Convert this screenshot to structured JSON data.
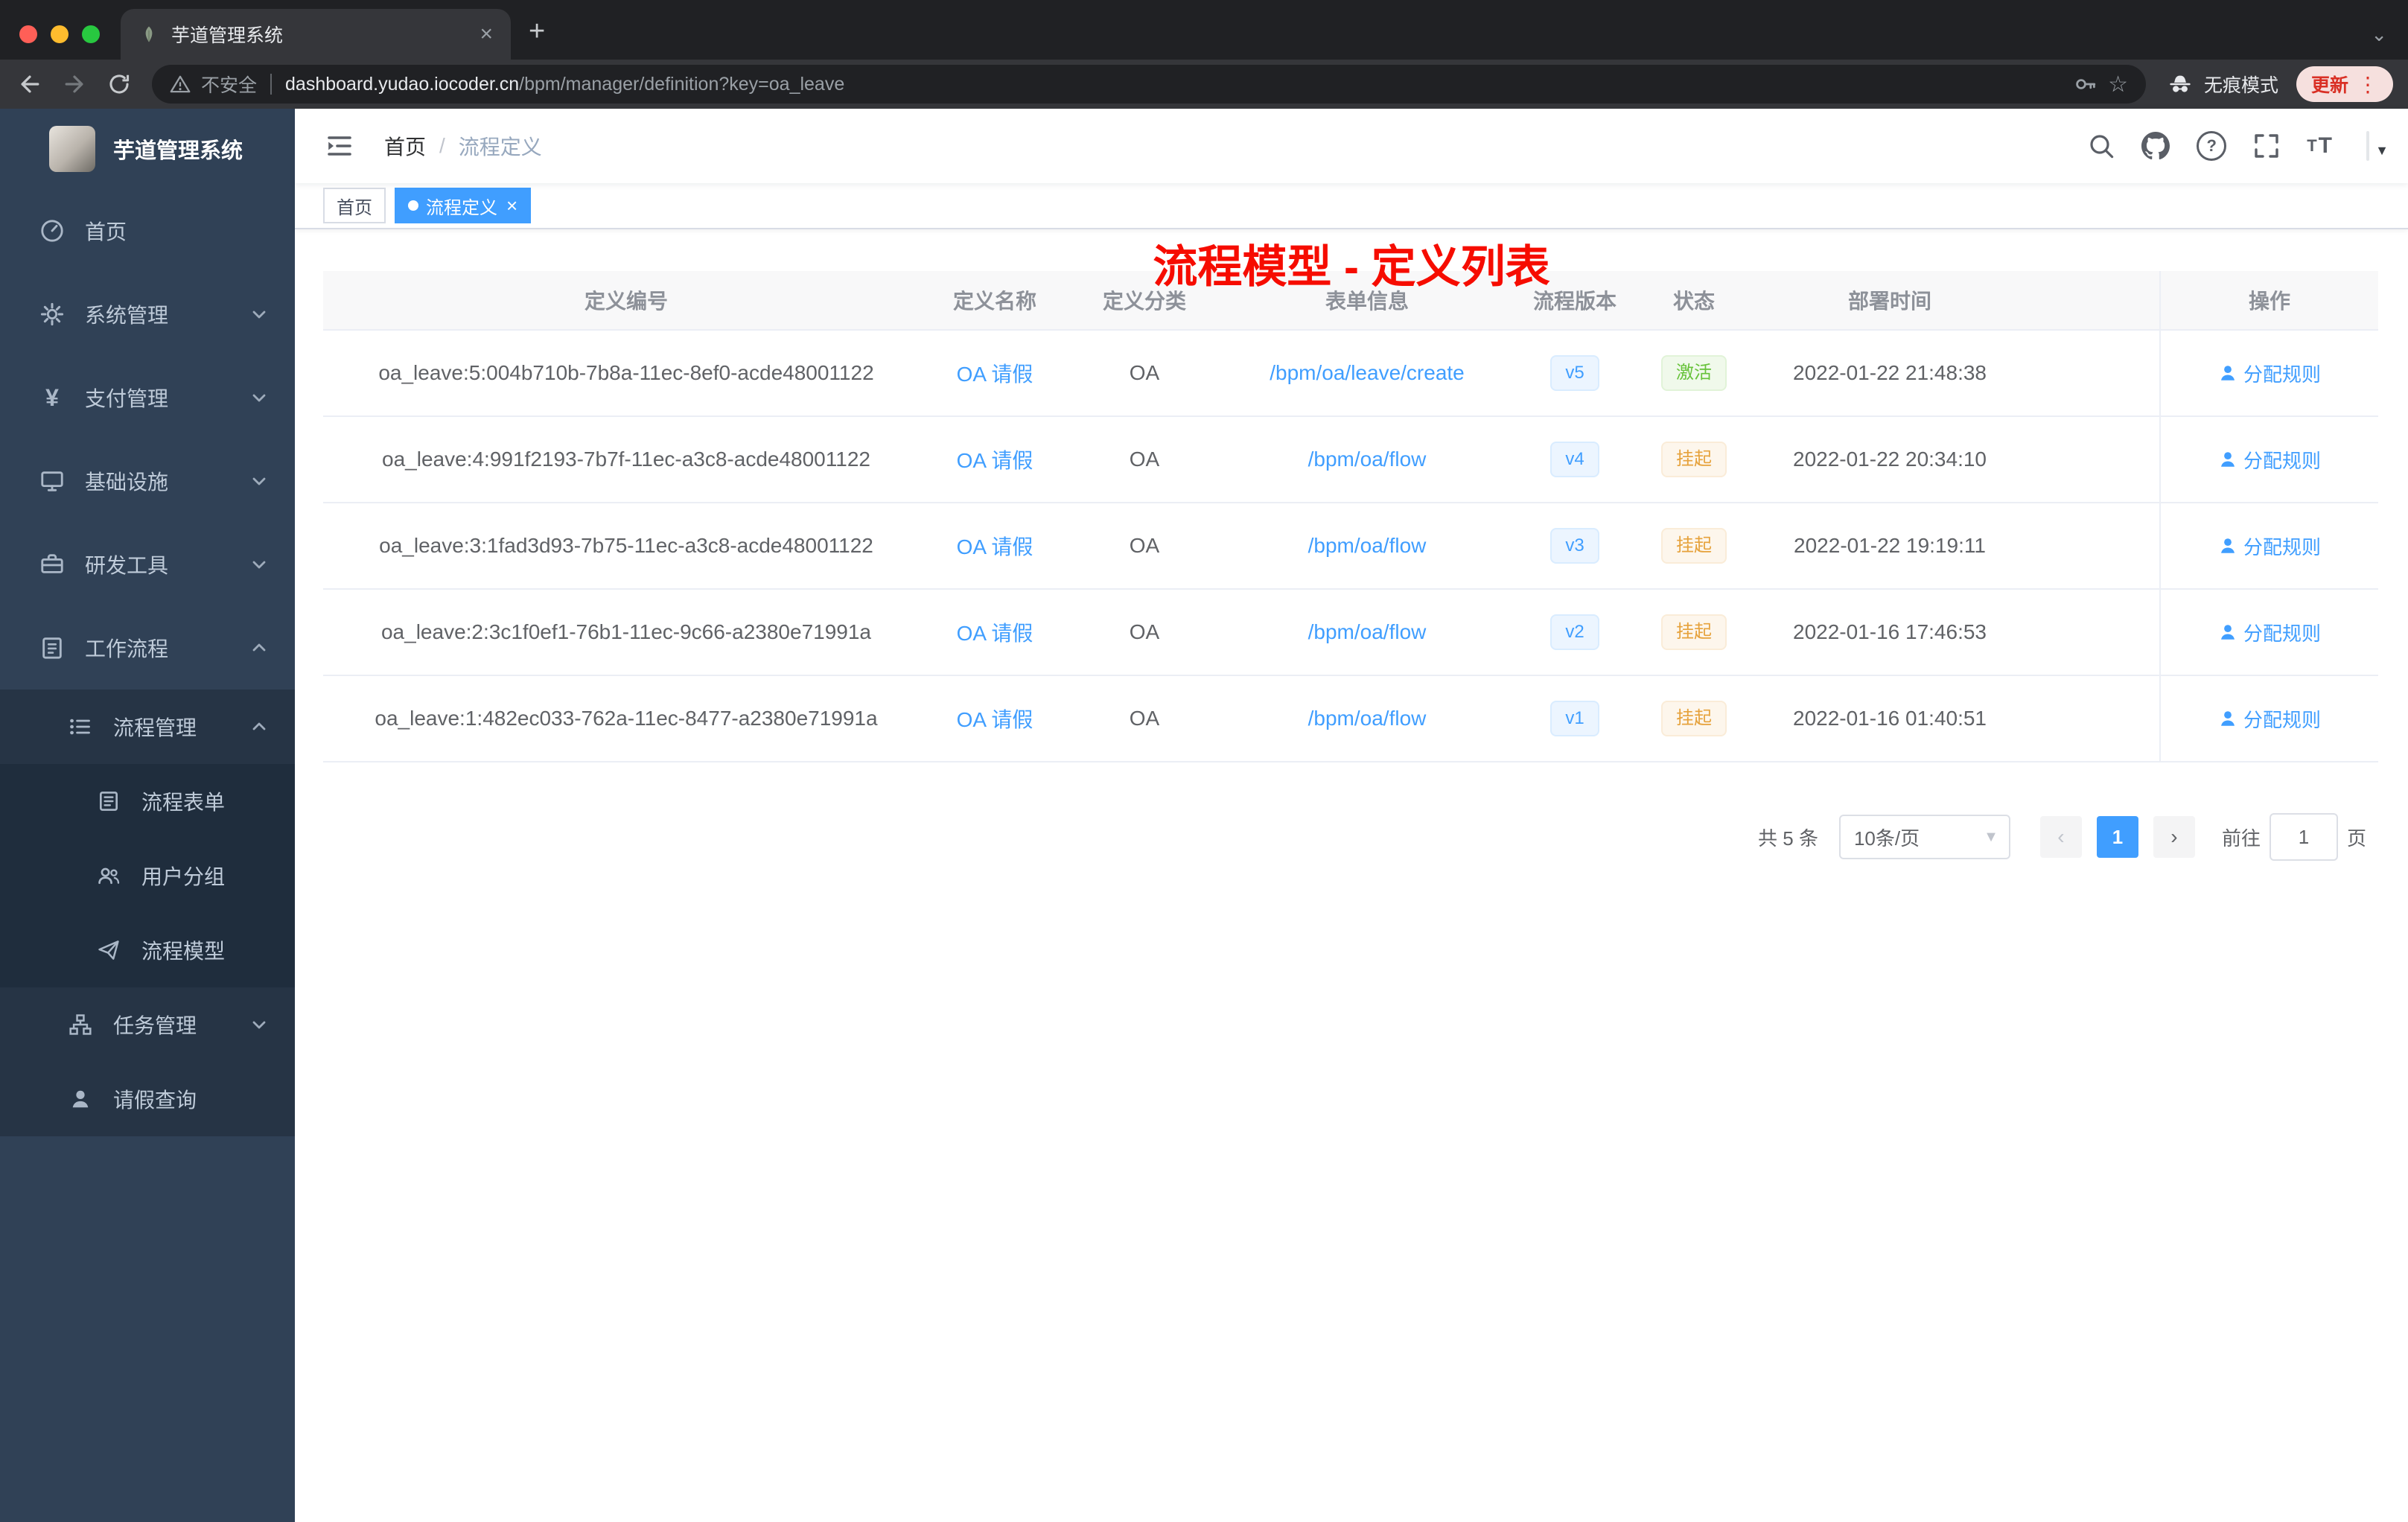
{
  "browser": {
    "tab_title": "芋道管理系统",
    "security_label": "不安全",
    "url_host": "dashboard.yudao.iocoder.cn",
    "url_path": "/bpm/manager/definition?key=oa_leave",
    "incognito_label": "无痕模式",
    "update_label": "更新"
  },
  "sidebar": {
    "logo_title": "芋道管理系统",
    "items": [
      {
        "key": "home",
        "label": "首页",
        "icon": "dashboard",
        "level": 0,
        "chevron": null
      },
      {
        "key": "system-manage",
        "label": "系统管理",
        "icon": "gear",
        "level": 0,
        "chevron": "down"
      },
      {
        "key": "payment-manage",
        "label": "支付管理",
        "icon": "yen",
        "level": 0,
        "chevron": "down"
      },
      {
        "key": "infrastructure",
        "label": "基础设施",
        "icon": "monitor",
        "level": 0,
        "chevron": "down"
      },
      {
        "key": "dev-tools",
        "label": "研发工具",
        "icon": "briefcase",
        "level": 0,
        "chevron": "down"
      },
      {
        "key": "workflow",
        "label": "工作流程",
        "icon": "clipboard",
        "level": 0,
        "chevron": "up"
      },
      {
        "key": "process-manage",
        "label": "流程管理",
        "icon": "list",
        "level": 1,
        "chevron": "up"
      },
      {
        "key": "process-form",
        "label": "流程表单",
        "icon": "form",
        "level": 2,
        "chevron": null
      },
      {
        "key": "user-group",
        "label": "用户分组",
        "icon": "user-group",
        "level": 2,
        "chevron": null
      },
      {
        "key": "process-model",
        "label": "流程模型",
        "icon": "paper-plane",
        "level": 2,
        "chevron": null
      },
      {
        "key": "task-manage",
        "label": "任务管理",
        "icon": "org",
        "level": 1,
        "chevron": "down"
      },
      {
        "key": "leave-query",
        "label": "请假查询",
        "icon": "person",
        "level": 1,
        "chevron": null
      }
    ]
  },
  "header": {
    "breadcrumb": [
      "首页",
      "流程定义"
    ],
    "annotation": "流程模型 - 定义列表"
  },
  "tags": [
    {
      "label": "首页",
      "active": false,
      "closable": false
    },
    {
      "label": "流程定义",
      "active": true,
      "closable": true
    }
  ],
  "table": {
    "columns": [
      "定义编号",
      "定义名称",
      "定义分类",
      "表单信息",
      "流程版本",
      "状态",
      "部署时间",
      "操作"
    ],
    "rows": [
      {
        "id": "oa_leave:5:004b710b-7b8a-11ec-8ef0-acde48001122",
        "name": "OA 请假",
        "category": "OA",
        "form": "/bpm/oa/leave/create",
        "version": "v5",
        "status": "激活",
        "status_type": "success",
        "deployed": "2022-01-22 21:48:38",
        "action": "分配规则"
      },
      {
        "id": "oa_leave:4:991f2193-7b7f-11ec-a3c8-acde48001122",
        "name": "OA 请假",
        "category": "OA",
        "form": "/bpm/oa/flow",
        "version": "v4",
        "status": "挂起",
        "status_type": "warning",
        "deployed": "2022-01-22 20:34:10",
        "action": "分配规则"
      },
      {
        "id": "oa_leave:3:1fad3d93-7b75-11ec-a3c8-acde48001122",
        "name": "OA 请假",
        "category": "OA",
        "form": "/bpm/oa/flow",
        "version": "v3",
        "status": "挂起",
        "status_type": "warning",
        "deployed": "2022-01-22 19:19:11",
        "action": "分配规则"
      },
      {
        "id": "oa_leave:2:3c1f0ef1-76b1-11ec-9c66-a2380e71991a",
        "name": "OA 请假",
        "category": "OA",
        "form": "/bpm/oa/flow",
        "version": "v2",
        "status": "挂起",
        "status_type": "warning",
        "deployed": "2022-01-16 17:46:53",
        "action": "分配规则"
      },
      {
        "id": "oa_leave:1:482ec033-762a-11ec-8477-a2380e71991a",
        "name": "OA 请假",
        "category": "OA",
        "form": "/bpm/oa/flow",
        "version": "v1",
        "status": "挂起",
        "status_type": "warning",
        "deployed": "2022-01-16 01:40:51",
        "action": "分配规则"
      }
    ]
  },
  "pagination": {
    "total": "共 5 条",
    "page_size": "10条/页",
    "current_page": "1",
    "goto_label": "前往",
    "goto_value": "1",
    "unit_label": "页"
  },
  "colors": {
    "accent": "#409eff",
    "success": "#67c23a",
    "warning": "#e6a23c",
    "annotation_red": "#f60c00",
    "sidebar_bg": "#304156"
  }
}
